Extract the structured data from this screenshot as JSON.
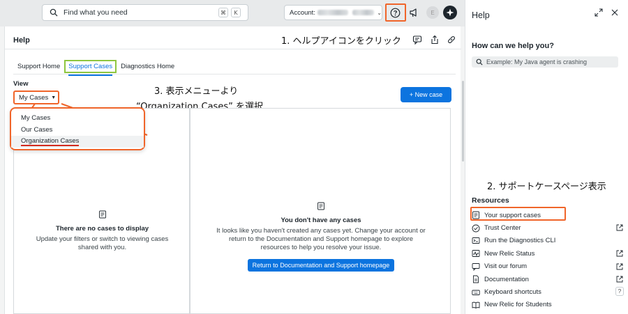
{
  "topbar": {
    "search_placeholder": "Find what you need",
    "kbd_cmd": "⌘",
    "kbd_k": "K",
    "account_label": "Account:",
    "avatar_initial": "E"
  },
  "main": {
    "title": "Help",
    "annotation1": "1. ヘルプアイコンをクリック",
    "tabs": [
      "Support Home",
      "Support Cases",
      "Diagnostics Home"
    ],
    "view_label": "View",
    "view_value": "My Cases",
    "annotation3_line1": "3. 表示メニューより",
    "annotation3_line2": "“Organization Cases” を選択",
    "new_case_label": "+ New case",
    "dropdown_options": [
      "My Cases",
      "Our Cases",
      "Organization Cases"
    ],
    "empty_left": {
      "heading": "There are no cases to display",
      "body": "Update your filters or switch to viewing cases shared with you."
    },
    "empty_right": {
      "heading": "You don't have any cases",
      "body": "It looks like you haven't created any cases yet. Change your account or return to the Documentation and Support homepage to explore resources to help you resolve your issue.",
      "button": "Return to Documentation and Support homepage"
    }
  },
  "help_panel": {
    "title": "Help",
    "question": "How can we help you?",
    "search_placeholder": "Example: My Java agent is crashing",
    "annotation2": "2. サポートケースページ表示",
    "resources_title": "Resources",
    "resources": [
      {
        "label": "Your support cases",
        "icon": "doc-list-icon"
      },
      {
        "label": "Trust Center",
        "icon": "check-circle-icon"
      },
      {
        "label": "Run the Diagnostics CLI",
        "icon": "diagnostics-icon"
      },
      {
        "label": "New Relic Status",
        "icon": "status-icon"
      },
      {
        "label": "Visit our forum",
        "icon": "forum-icon"
      },
      {
        "label": "Documentation",
        "icon": "document-icon"
      },
      {
        "label": "Keyboard shortcuts",
        "icon": "keyboard-icon"
      },
      {
        "label": "New Relic for Students",
        "icon": "book-icon"
      }
    ],
    "shortcut_key": "?"
  },
  "colors": {
    "accent_blue": "#0c74df",
    "annotation_orange": "#f0652a",
    "tab_highlight_green": "#8ec63f",
    "underline_red": "#d32a1f"
  }
}
